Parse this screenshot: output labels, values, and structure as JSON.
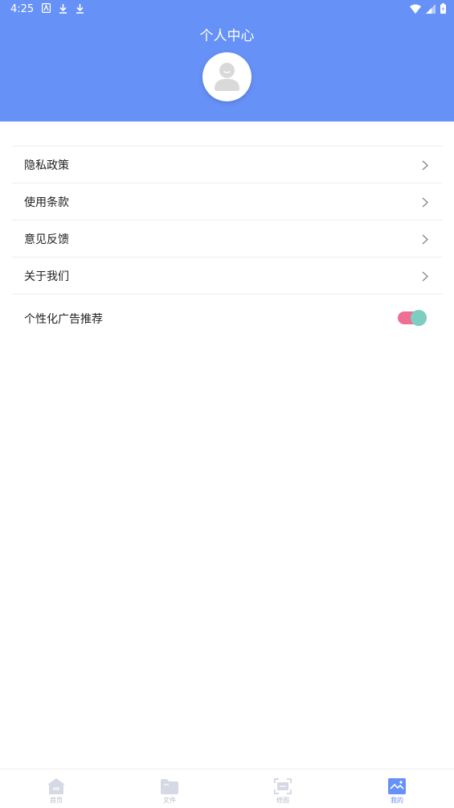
{
  "status_bar": {
    "time": "4:25"
  },
  "header": {
    "title": "个人中心"
  },
  "menu": {
    "items": [
      {
        "label": "隐私政策"
      },
      {
        "label": "使用条款"
      },
      {
        "label": "意见反馈"
      },
      {
        "label": "关于我们"
      }
    ],
    "toggle_item": {
      "label": "个性化广告推荐",
      "enabled": true
    }
  },
  "bottom_nav": {
    "items": [
      {
        "label": "首页",
        "icon": "home-icon"
      },
      {
        "label": "文件",
        "icon": "folder-icon"
      },
      {
        "label": "修图",
        "icon": "crop-icon"
      },
      {
        "label": "我的",
        "icon": "image-icon",
        "active": true
      }
    ]
  },
  "colors": {
    "header": "#6691f7",
    "toggle_track": "#ee6e94",
    "toggle_knob": "#7ecdc1",
    "nav_active": "#6691f7",
    "nav_inactive": "#d6d9e3"
  }
}
